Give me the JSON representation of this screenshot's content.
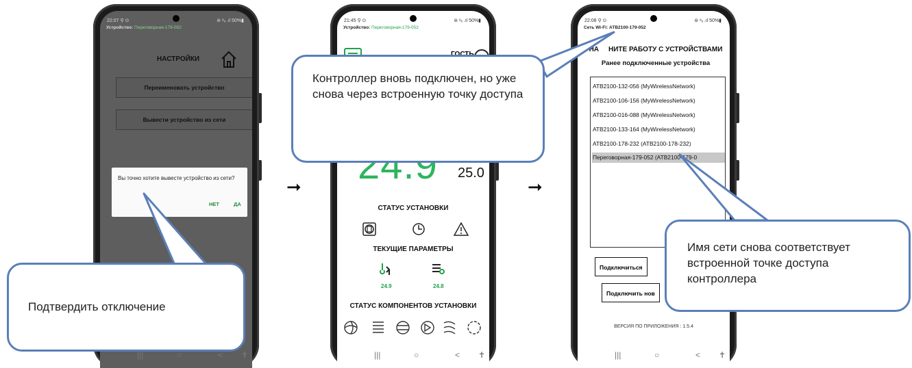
{
  "phone1": {
    "status_time": "22:07 ⚲ ⊙",
    "status_right": "⊜ ᵃᵢᵢ .ıl 50%▮",
    "device_label": "Устройство:",
    "device_name": "Переговорная-179-052",
    "title": "НАСТРОЙКИ",
    "rename_button": "Переименовать устройство",
    "remove_button": "Вывести устройство из сети",
    "dialog_message": "Вы точно хотите вывесте устройство из сети?",
    "dialog_no": "НЕТ",
    "dialog_yes": "ДА",
    "nav_recent": "|||",
    "nav_home": "○",
    "nav_back": "<",
    "nav_access": "✝"
  },
  "phone2": {
    "status_time": "21:45 ⚲ ⊙",
    "status_right": "⊜ ᵃᵢᵢ .ıl 50%▮",
    "device_label": "Устройство:",
    "device_name": "Переговорная-179-052",
    "guest": "ГОСТЬ",
    "current_temp": "24.9",
    "set_temp": "25.0",
    "install_status_heading": "СТАТУС УСТАНОВКИ",
    "current_params_heading": "ТЕКУЩИЕ ПАРАМЕТРЫ",
    "param1_value": "24.9",
    "param2_value": "24.8",
    "components_heading": "СТАТУС КОМПОНЕНТОВ УСТАНОВКИ",
    "nav_recent": "|||",
    "nav_home": "○",
    "nav_back": "<",
    "nav_access": "✝"
  },
  "phone3": {
    "status_time": "22:08 ⚲ ⊙",
    "status_right": "⊜ ᵃᵢᵢ .ıl 50%▮",
    "wifi_label": "Сеть Wi-Fi: АТВ2100-179-052",
    "heading_start": "НА",
    "heading_end": "НИТЕ РАБОТУ С УСТРОЙСТВАМИ",
    "subheading": "Ранее подключенные устройства",
    "devices": [
      "АТВ2100-132-056 (MyWirelessNetwork)",
      "АТВ2100-106-156 (MyWirelessNetwork)",
      "АТВ2100-016-088 (MyWirelessNetwork)",
      "АТВ2100-133-164 (MyWirelessNetwork)",
      "АТВ2100-178-232 (АТВ2100-178-232)",
      "Переговорная-179-052 (АТВ2100-179-0"
    ],
    "connect_button": "Подключиться",
    "connect_new_button": "Подключить нов",
    "version": "ВЕРСИЯ ПО ПРИЛОЖЕНИЯ : 1.5.4",
    "nav_recent": "|||",
    "nav_home": "○",
    "nav_back": "<",
    "nav_access": "✝"
  },
  "callouts": {
    "confirm": "Подтвердить отключение",
    "reconnected": "Контроллер вновь подключен, но уже снова через встроенную точку доступа",
    "network_name": "Имя сети снова соответствует встроенной точке доступа контроллера"
  },
  "flow_arrow": "➞",
  "colors": {
    "accent_green": "#1fa24a",
    "callout_border": "#5a7fb8"
  }
}
